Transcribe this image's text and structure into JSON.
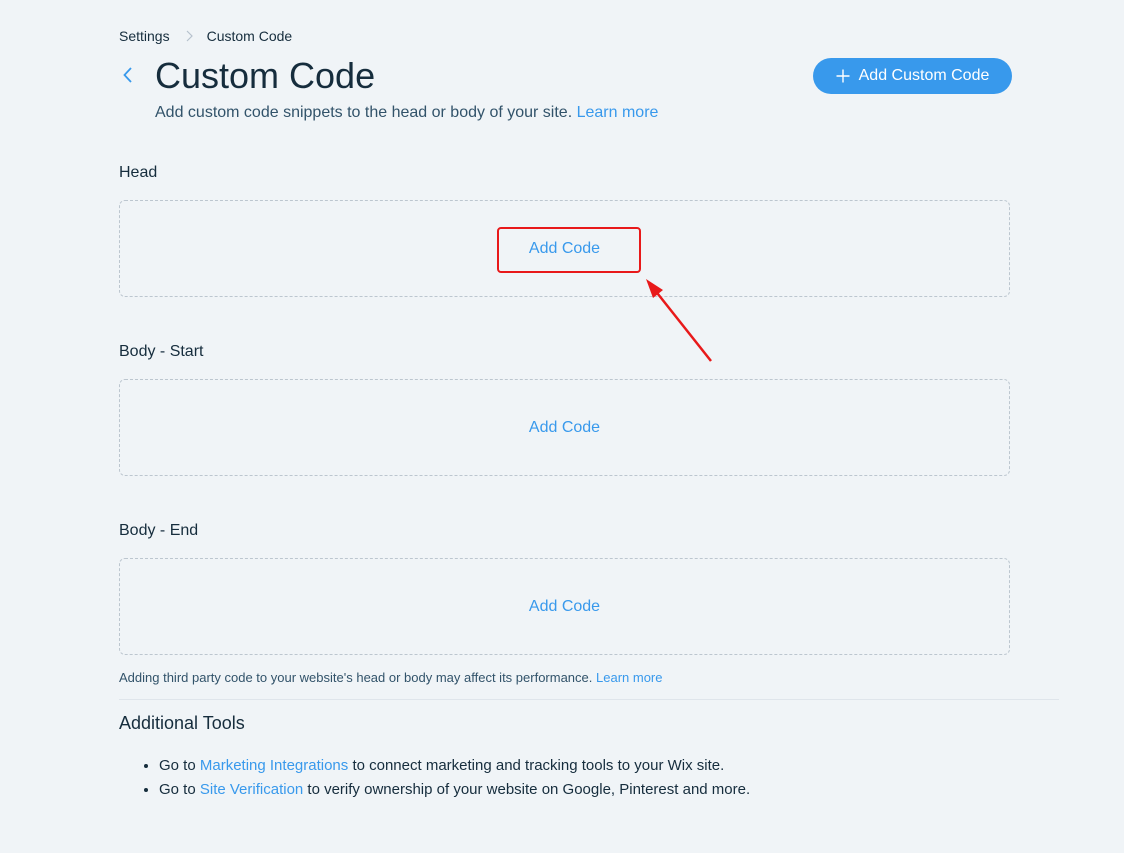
{
  "breadcrumb": {
    "items": [
      "Settings",
      "Custom Code"
    ]
  },
  "header": {
    "title": "Custom Code",
    "subtitle": "Add custom code snippets to the head or body of your site.",
    "learn_more": "Learn more",
    "add_button": "Add Custom Code"
  },
  "sections": [
    {
      "label": "Head",
      "action": "Add Code"
    },
    {
      "label": "Body - Start",
      "action": "Add Code"
    },
    {
      "label": "Body - End",
      "action": "Add Code"
    }
  ],
  "footnote": {
    "text": "Adding third party code to your website's head or body may affect its performance.",
    "link": "Learn more"
  },
  "additional_tools": {
    "title": "Additional Tools",
    "items": [
      {
        "prefix": "Go to ",
        "link": "Marketing Integrations",
        "suffix": " to connect marketing and tracking tools to your Wix site."
      },
      {
        "prefix": "Go to ",
        "link": "Site Verification",
        "suffix": " to verify ownership of your website on Google, Pinterest and more."
      }
    ]
  },
  "colors": {
    "background": "#f0f4f7",
    "accent": "#3899ec",
    "text": "#162d3d",
    "annotation": "#e8191a"
  },
  "icons": {
    "breadcrumb_separator": "chevron-right-icon",
    "back": "chevron-left-icon",
    "add": "plus-icon"
  }
}
